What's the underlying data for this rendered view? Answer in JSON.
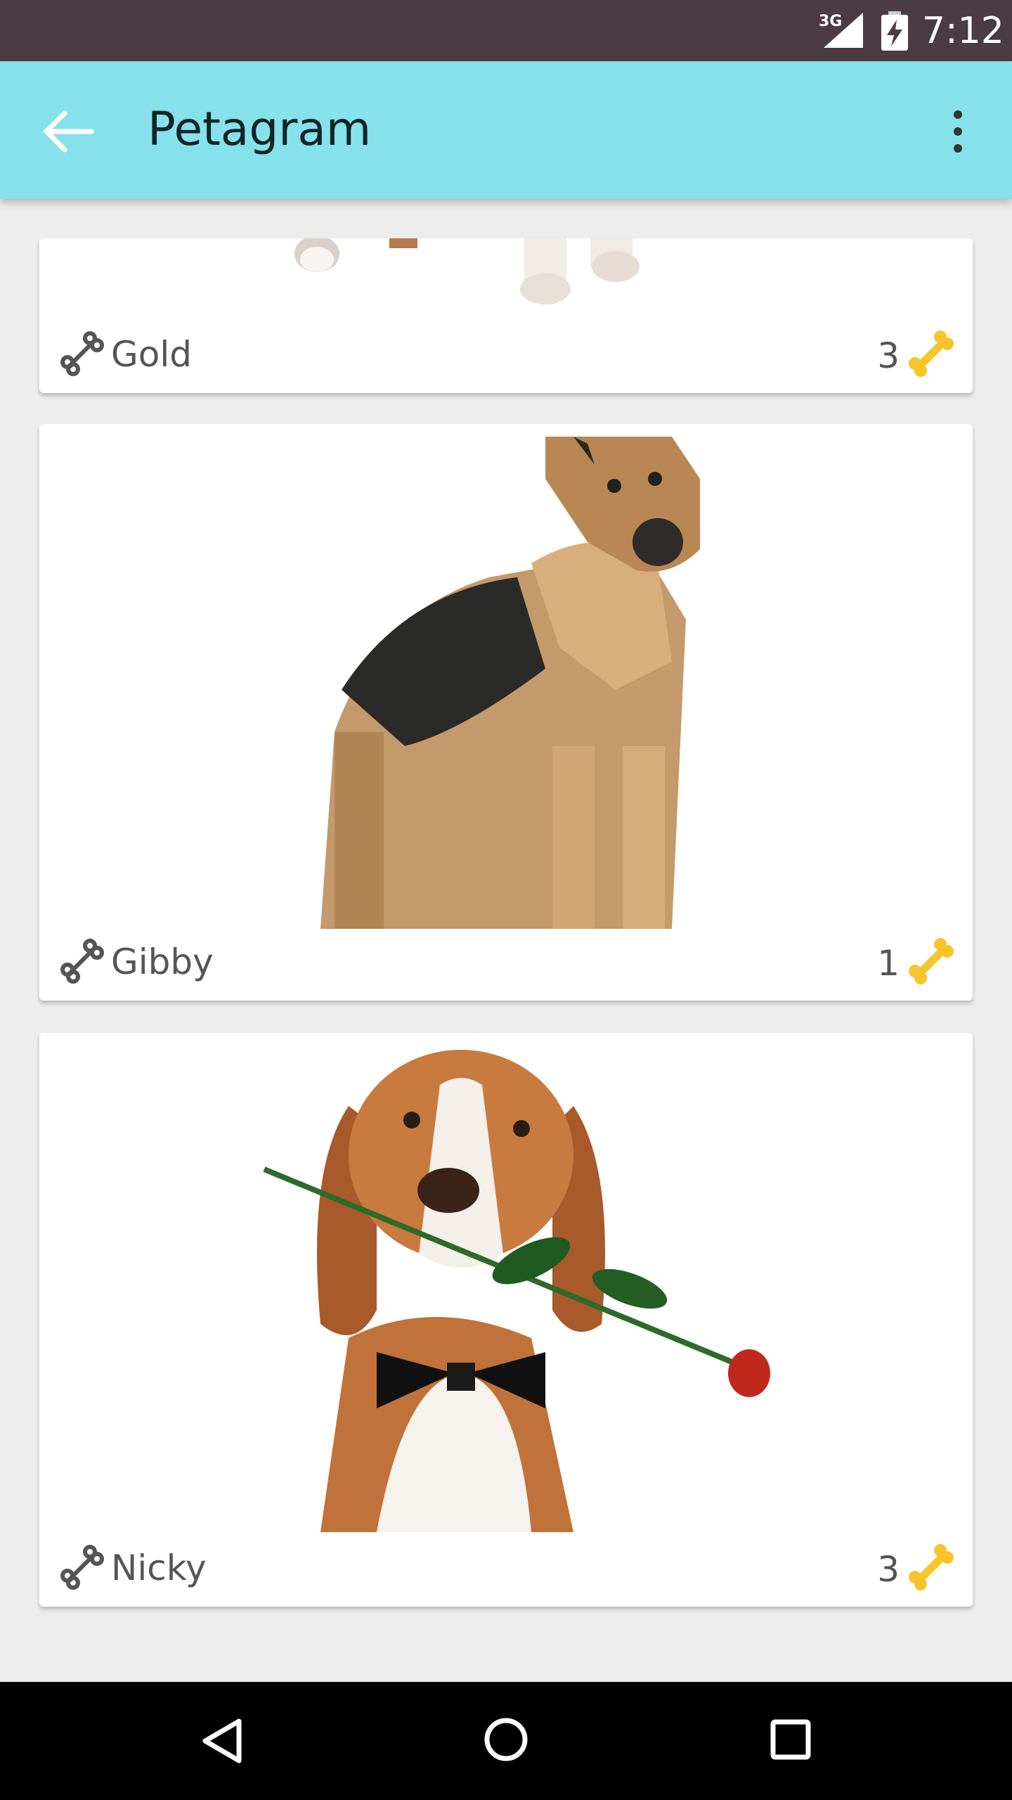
{
  "status_bar": {
    "network": "3G",
    "time": "7:12",
    "icons": [
      "signal-icon",
      "battery-charging-icon"
    ]
  },
  "app_bar": {
    "title": "Petagram",
    "icons": [
      "back-arrow-icon",
      "overflow-menu-icon"
    ]
  },
  "pets": [
    {
      "name": "Gold",
      "likes": "3"
    },
    {
      "name": "Gibby",
      "likes": "1"
    },
    {
      "name": "Nicky",
      "likes": "3"
    }
  ],
  "nav_bar": {
    "icons": [
      "back-triangle-icon",
      "home-circle-icon",
      "recents-square-icon"
    ]
  },
  "colors": {
    "status_bar": "#4a3c42",
    "app_bar": "#86e1ea",
    "bone_outline": "#555555",
    "bone_gold": "#f7c52b",
    "background": "#ededed"
  }
}
